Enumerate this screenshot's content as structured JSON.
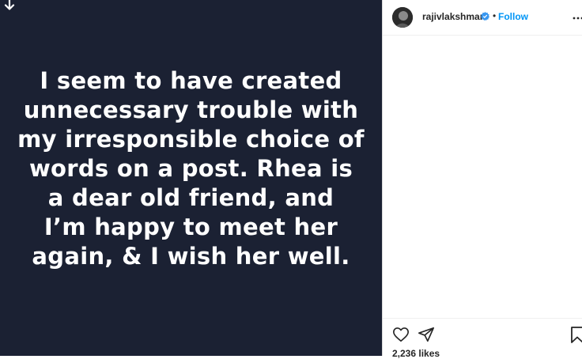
{
  "post": {
    "caption": "I seem to have created\nunnecessary trouble with\nmy irresponsible choice of\nwords on a post. Rhea is\na dear old friend, and\nI’m happy to meet her\nagain, & I wish her well.",
    "background_color": "#1b2133",
    "text_color": "#ffffff",
    "download_icon": "download-arrow-icon"
  },
  "header": {
    "username": "rajivlakshman",
    "verified_icon": "verified-badge-icon",
    "separator": "•",
    "follow_label": "Follow",
    "more_icon": "more-options-icon"
  },
  "actions": {
    "like_icon": "heart-icon",
    "share_icon": "share-icon",
    "save_icon": "bookmark-icon",
    "likes_text": "2,236 likes"
  },
  "colors": {
    "accent": "#0095f6",
    "verified": "#3897f0"
  }
}
